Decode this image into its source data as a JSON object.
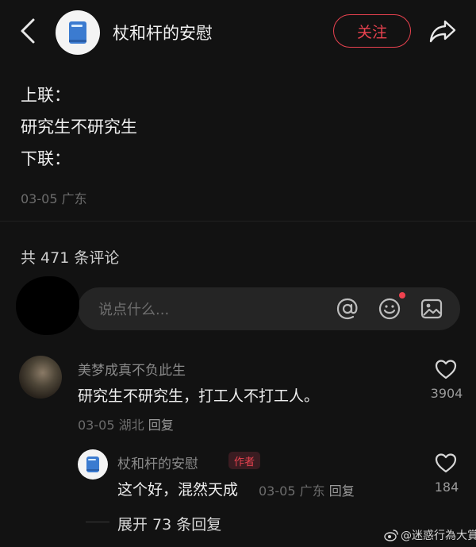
{
  "header": {
    "author_name": "杖和杆的安慰",
    "follow_label": "关注"
  },
  "post": {
    "lines": [
      "上联：",
      "研究生不研究生",
      "下联："
    ],
    "date": "03-05",
    "location": "广东"
  },
  "comments_section": {
    "count_label": "共 471 条评论",
    "input_placeholder": "说点什么..."
  },
  "comments": [
    {
      "username": "美梦成真不负此生",
      "text": "研究生不研究生，打工人不打工人。",
      "date": "03-05",
      "location": "湖北",
      "reply_label": "回复",
      "likes": "3904"
    }
  ],
  "replies": [
    {
      "username": "杖和杆的安慰",
      "badge": "作者",
      "text": "这个好，混然天成",
      "date": "03-05",
      "location": "广东",
      "reply_label": "回复",
      "likes": "184"
    }
  ],
  "expand_label": "展开 73 条回复",
  "watermark": "@迷惑行為大賞",
  "colors": {
    "background": "#121212",
    "accent_red": "#e8424f",
    "input_bg": "#252525",
    "muted_text": "#6c6c6c"
  },
  "icons": [
    "back-icon",
    "share-icon",
    "at-icon",
    "emoji-icon",
    "image-icon",
    "heart-icon",
    "weibo-icon"
  ]
}
